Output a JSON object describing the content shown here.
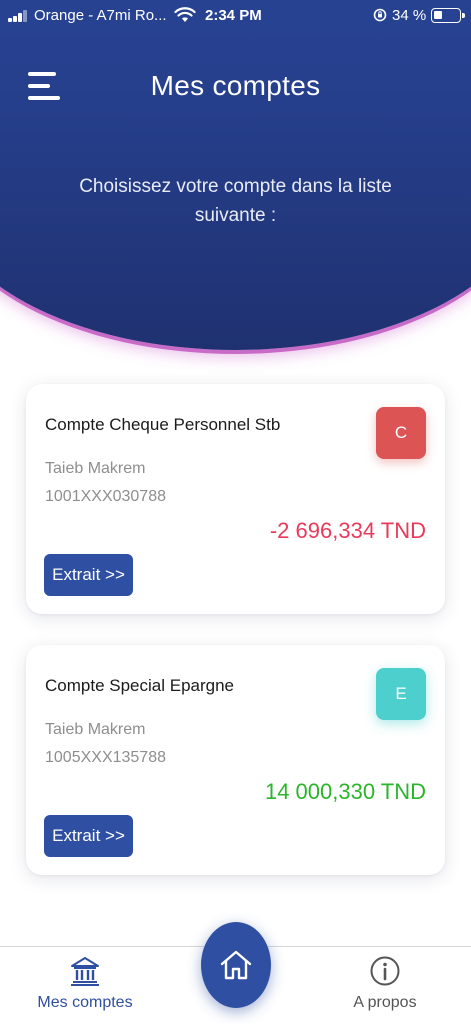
{
  "status_bar": {
    "carrier": "Orange - A7mi Ro...",
    "time": "2:34 PM",
    "battery_percent": "34 %",
    "battery_level": 0.34,
    "signal_icon": "signal-bars-icon",
    "wifi_icon": "wifi-icon",
    "lock_icon": "orientation-lock-icon"
  },
  "header": {
    "menu_icon": "hamburger-menu-icon",
    "title": "Mes comptes",
    "subtitle": "Choisissez votre compte dans la liste suivante :"
  },
  "accounts": [
    {
      "name": "Compte Cheque Personnel Stb",
      "holder": "Taieb Makrem",
      "number": "1001XXX030788",
      "badge": "C",
      "badge_color": "#dc5454",
      "amount": "-2 696,334 TND",
      "amount_color": "#ea3a5a",
      "button_label": "Extrait >>"
    },
    {
      "name": "Compte Special Epargne",
      "holder": "Taieb Makrem",
      "number": "1005XXX135788",
      "badge": "E",
      "badge_color": "#4ccfcd",
      "amount": "14 000,330 TND",
      "amount_color": "#2bb52b",
      "button_label": "Extrait >>"
    }
  ],
  "tabbar": {
    "accounts_label": "Mes comptes",
    "accounts_icon": "bank-icon",
    "home_icon": "home-icon",
    "about_label": "A propos",
    "about_icon": "info-icon"
  },
  "colors": {
    "brand_blue": "#2f4fa2",
    "header_blue": "#263f8c",
    "accent_pink": "#c86bc8"
  }
}
